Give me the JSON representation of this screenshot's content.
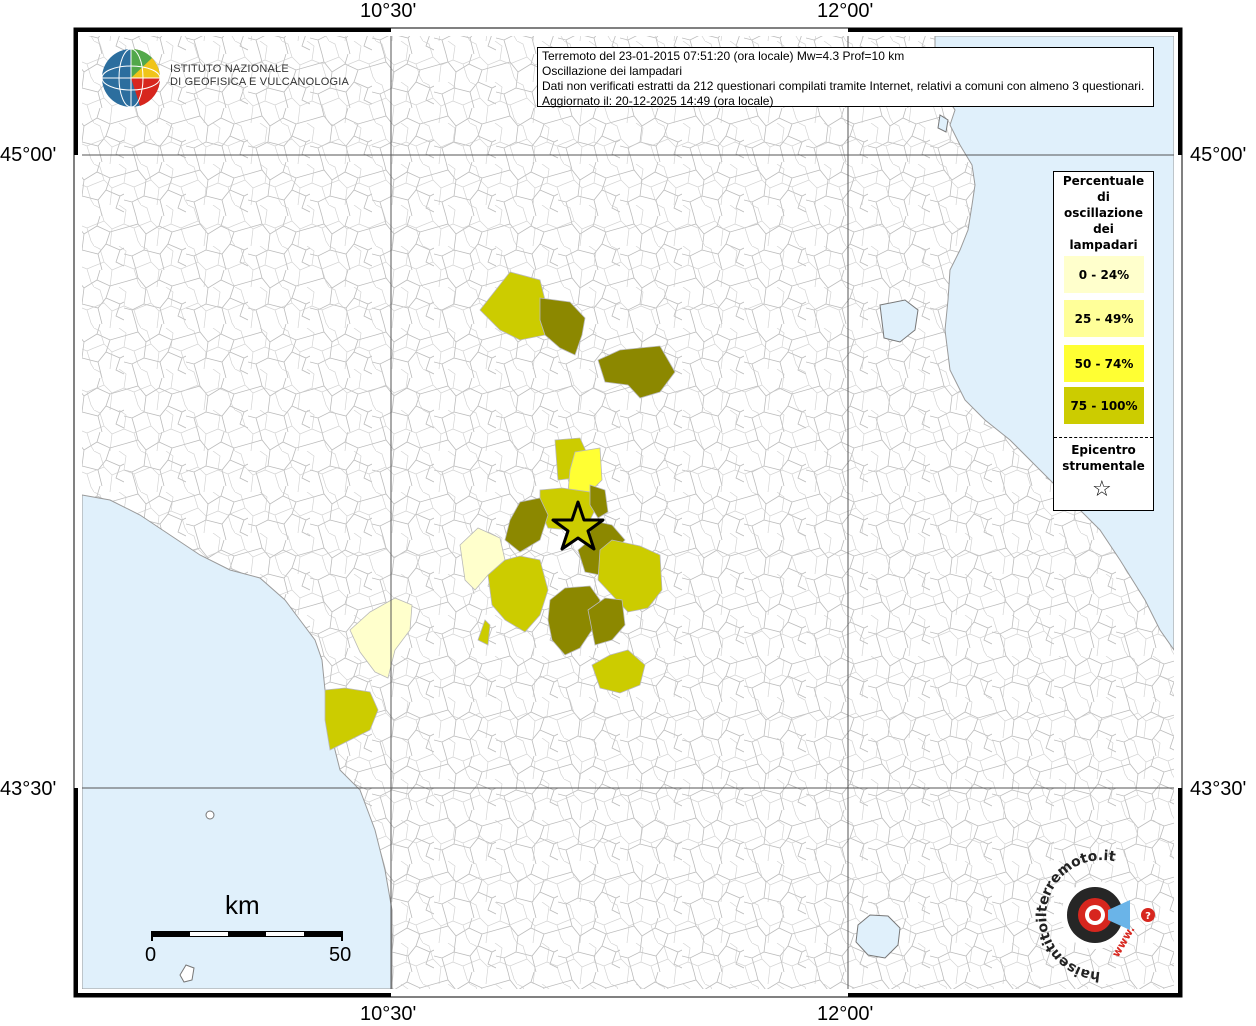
{
  "map": {
    "longitude_labels": [
      "10°30'",
      "12°00'"
    ],
    "latitude_labels": [
      "45°00'",
      "43°30'"
    ]
  },
  "header": {
    "line1": "Terremoto del 23-01-2015 07:51:20 (ora locale) Mw=4.3 Prof=10 km",
    "line2": "Oscillazione dei lampadari",
    "line3": "Dati non verificati estratti da 212 questionari compilati tramite Internet, relativi a comuni con almeno 3 questionari.",
    "line4": "Aggiornato il: 20-12-2025 14:49 (ora locale)"
  },
  "institute_logo": {
    "line1": "ISTITUTO NAZIONALE",
    "line2": "DI GEOFISICA E VULCANOLOGIA"
  },
  "legend": {
    "title_lines": [
      "Percentuale",
      "di",
      "oscillazione",
      "dei",
      "lampadari"
    ],
    "classes": [
      {
        "label": "0 - 24%",
        "color": "#ffffcc"
      },
      {
        "label": "25 - 49%",
        "color": "#ffff99"
      },
      {
        "label": "50 - 74%",
        "color": "#ffff33"
      },
      {
        "label": "75 - 100%",
        "color": "#cccc00"
      }
    ],
    "epicenter_lines": [
      "Epicentro",
      "strumentale"
    ],
    "epicenter_symbol": "☆"
  },
  "scale_bar": {
    "unit": "km",
    "min_label": "0",
    "max_label": "50"
  },
  "hsit_logo": {
    "text": "haisentitoilterremoto.it",
    "sub": "www."
  },
  "colors": {
    "sea": "#e0f0fb",
    "land": "#ffffff",
    "border": "#b4b4b4",
    "dark_olive": "#8c8800",
    "olive": "#cccc00",
    "light": "#ffffcc",
    "yellow": "#ffff33"
  }
}
